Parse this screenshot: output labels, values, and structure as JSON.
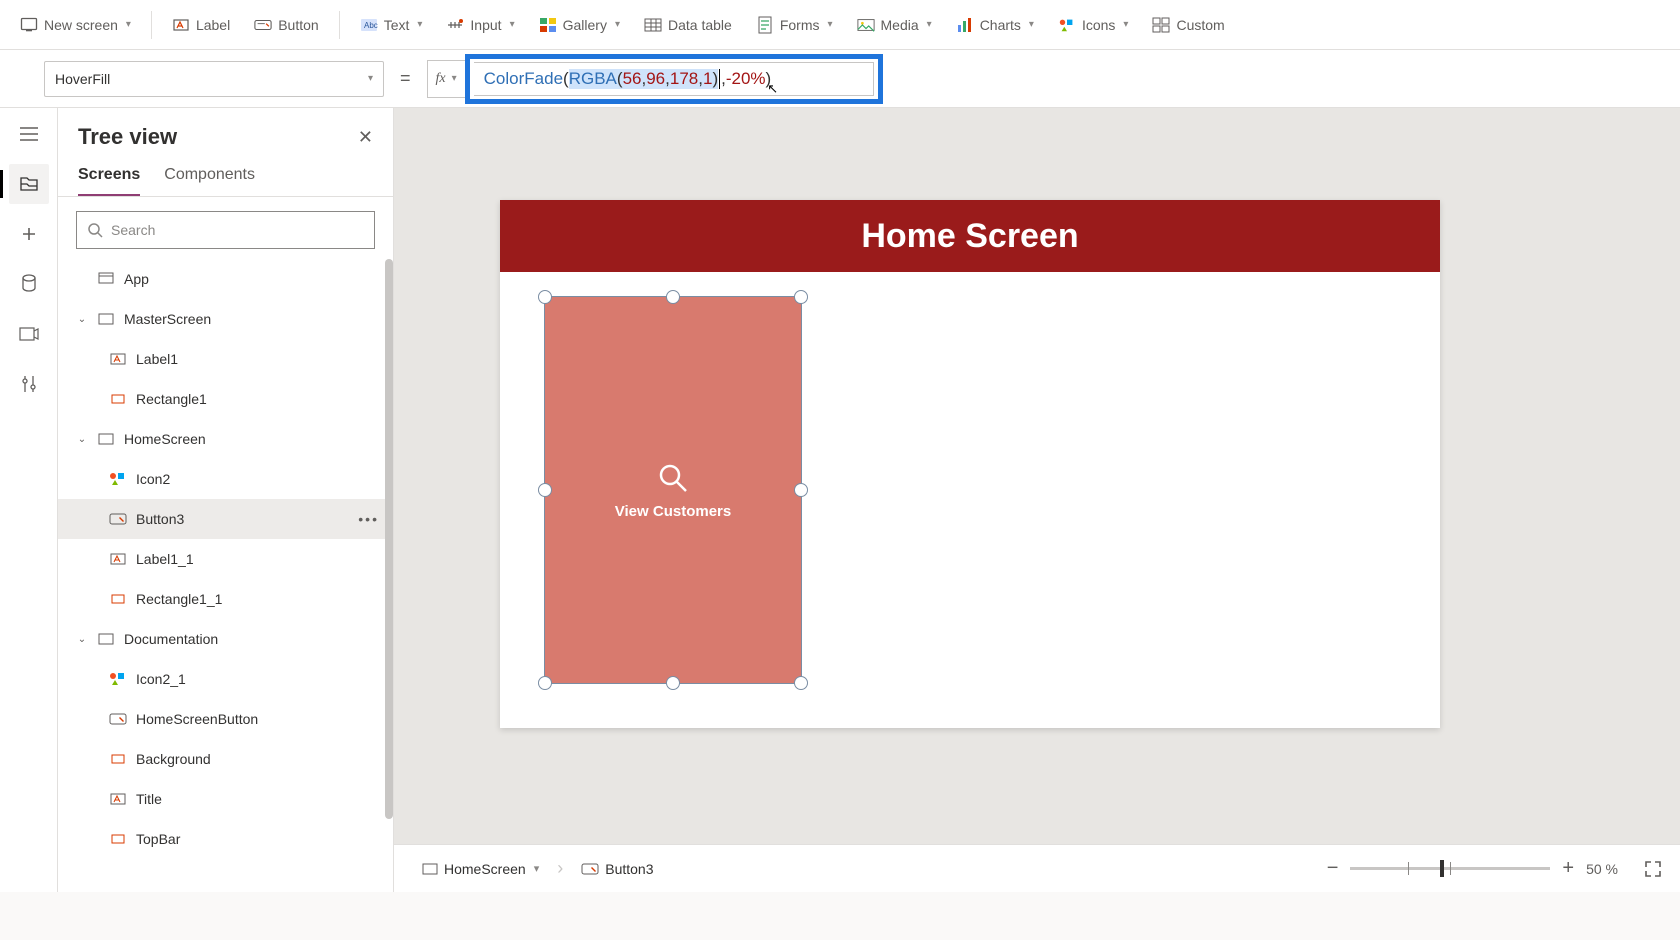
{
  "ribbon": {
    "new_screen": "New screen",
    "label": "Label",
    "button": "Button",
    "text": "Text",
    "input": "Input",
    "gallery": "Gallery",
    "data_table": "Data table",
    "forms": "Forms",
    "media": "Media",
    "charts": "Charts",
    "icons": "Icons",
    "custom": "Custom"
  },
  "property_dropdown": "HoverFill",
  "formula": {
    "fn1": "ColorFade",
    "open1": "(",
    "fn2": "RGBA",
    "open2": "(",
    "n1": "56",
    "c": ", ",
    "n2": "96",
    "n3": "178",
    "n4": "1",
    "close2": ")",
    "comma2": ", ",
    "pct": "-20%",
    "close1": ")"
  },
  "tree": {
    "title": "Tree view",
    "tab_screens": "Screens",
    "tab_components": "Components",
    "search_placeholder": "Search",
    "app": "App",
    "master": "MasterScreen",
    "label1": "Label1",
    "rect1": "Rectangle1",
    "home": "HomeScreen",
    "icon2": "Icon2",
    "button3": "Button3",
    "label1_1": "Label1_1",
    "rect1_1": "Rectangle1_1",
    "doc": "Documentation",
    "icon2_1": "Icon2_1",
    "hsb": "HomeScreenButton",
    "bg": "Background",
    "title_item": "Title",
    "topbar": "TopBar"
  },
  "canvas": {
    "header": "Home Screen",
    "button_label": "View Customers"
  },
  "breadcrumb": {
    "screen": "HomeScreen",
    "control": "Button3"
  },
  "zoom": {
    "value": "50",
    "unit": "%"
  }
}
